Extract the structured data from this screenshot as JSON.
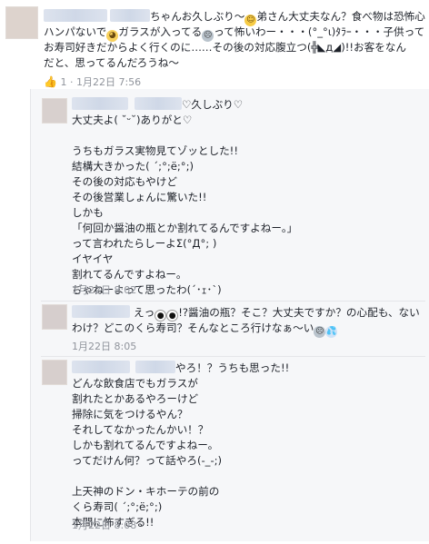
{
  "main_comment": {
    "author_suffix": "ちゃんお久しぶり〜",
    "lines": [
      {
        "pre": "",
        "post": "弟さん大丈夫なん？食べ物は恐怖心"
      },
      {
        "pre": "ハンパないで",
        "post": "ガラスが入ってる"
      },
      {
        "pre": "",
        "post": "って怖いわー・・・(°_°ι)ﾀﾗｰ・・・子供って"
      },
      {
        "pre": "お寿司好きだからよく行くのに……その後の対応腹立つ(╬◣д◢)!!お客をなん",
        "post": ""
      },
      {
        "pre": "だと、思ってるんだろうね〜",
        "post": ""
      }
    ],
    "like_count": "1",
    "time": "1月22日 7:56"
  },
  "replies": [
    {
      "author_suffix": "♡久しぶり♡",
      "lines": [
        "大丈夫よ( ˘ᵕ˘)ありがと♡",
        "",
        "うちもガラス実物見てゾッとした!!",
        "結構大きかった( ´;°;ё;°;)",
        "その後の対応もやけど",
        "その後営業しょんに驚いた!!",
        "しかも",
        "「何回か醤油の瓶とか割れてるんですよねー。」",
        "って言われたらしーよΣ(°Д°; )",
        "イヤイヤ",
        "割れてるんですよねー。",
        "ぢゃねーよって思ったわ(´･ｪ･`)"
      ],
      "time": "1月22日 8:02"
    },
    {
      "author_suffix": "えっ",
      "lines": [
        "!?醤油の瓶？そこ？大丈夫ですか？の心配も、ない",
        "わけ？どこのくら寿司？そんなところ行けなぁ〜い"
      ],
      "time": "1月22日 8:05"
    },
    {
      "author_suffix": "やろ！？うちも思った!!",
      "lines": [
        "どんな飲食店でもガラスが",
        "割れたとかあるやろーけど",
        "掃除に気をつけるやん？",
        "それしてなかったんかい！？",
        "しかも割れてるんですよねー。",
        "ってだけん何？って話やろ(-_-;)",
        "",
        "上天神のドン・キホーテの前の",
        "くら寿司( ´;°;ё;°;)",
        "本間に怖すぎる!!"
      ],
      "time": "1月22日 8:08"
    }
  ],
  "icons": {
    "like": "thumbs-up-icon",
    "smile": "smile-emoji-icon",
    "cry": "cry-emoji-icon",
    "scream": "scream-emoji-icon",
    "eyes": "eyes-emoji-icon",
    "sweat": "sweat-drops-icon"
  }
}
